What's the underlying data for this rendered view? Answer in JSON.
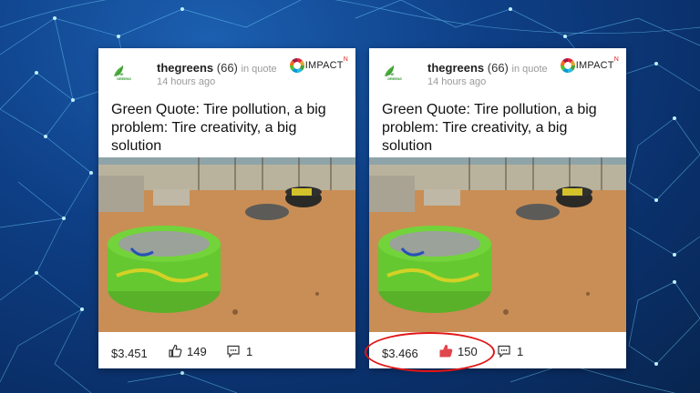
{
  "cards": [
    {
      "logo_text": "THE GREENS",
      "author": "thegreens",
      "reputation": "(66)",
      "in_label": "in quote",
      "time": "14 hours ago",
      "badge": "IMPACT",
      "badge_sup": "N",
      "title": "Green Quote: Tire pollution, a big problem: Tire creativity, a big solution",
      "payout": "$3.451",
      "likes": "149",
      "comments": "1",
      "liked": false
    },
    {
      "logo_text": "THE GREENS",
      "author": "thegreens",
      "reputation": "(66)",
      "in_label": "in quote",
      "time": "14 hours ago",
      "badge": "IMPACT",
      "badge_sup": "N",
      "title": "Green Quote: Tire pollution, a big problem: Tire creativity, a big solution",
      "payout": "$3.466",
      "likes": "150",
      "comments": "1",
      "liked": true
    }
  ],
  "colors": {
    "liked": "#e0464c",
    "highlight": "#e01616",
    "tire_green": "#5fc52d"
  },
  "icons": [
    "greens-logo-icon",
    "sdg-wheel-icon",
    "thumbs-up-icon",
    "comment-icon"
  ]
}
